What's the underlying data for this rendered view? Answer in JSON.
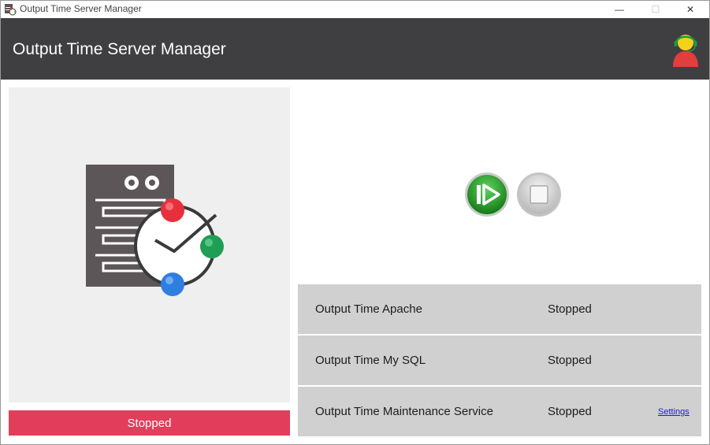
{
  "window": {
    "title": "Output Time Server Manager",
    "controls": {
      "minimize": "—",
      "maximize": "☐",
      "close": "✕"
    }
  },
  "header": {
    "title": "Output Time Server Manager",
    "avatar_icon": "support-agent-icon"
  },
  "server": {
    "illustration_icon": "server-clock-icon",
    "status": "Stopped",
    "status_color": "#e23e5b"
  },
  "controls": {
    "play_icon": "play-icon",
    "stop_icon": "stop-icon"
  },
  "services": [
    {
      "name": "Output Time Apache",
      "status": "Stopped",
      "link": ""
    },
    {
      "name": "Output Time My SQL",
      "status": "Stopped",
      "link": ""
    },
    {
      "name": "Output Time Maintenance Service",
      "status": "Stopped",
      "link": "Settings"
    }
  ],
  "colors": {
    "header_bg": "#3f3e40",
    "row_bg": "#d0d0d0",
    "panel_bg": "#efefef",
    "play_green": "#2ea02e"
  }
}
